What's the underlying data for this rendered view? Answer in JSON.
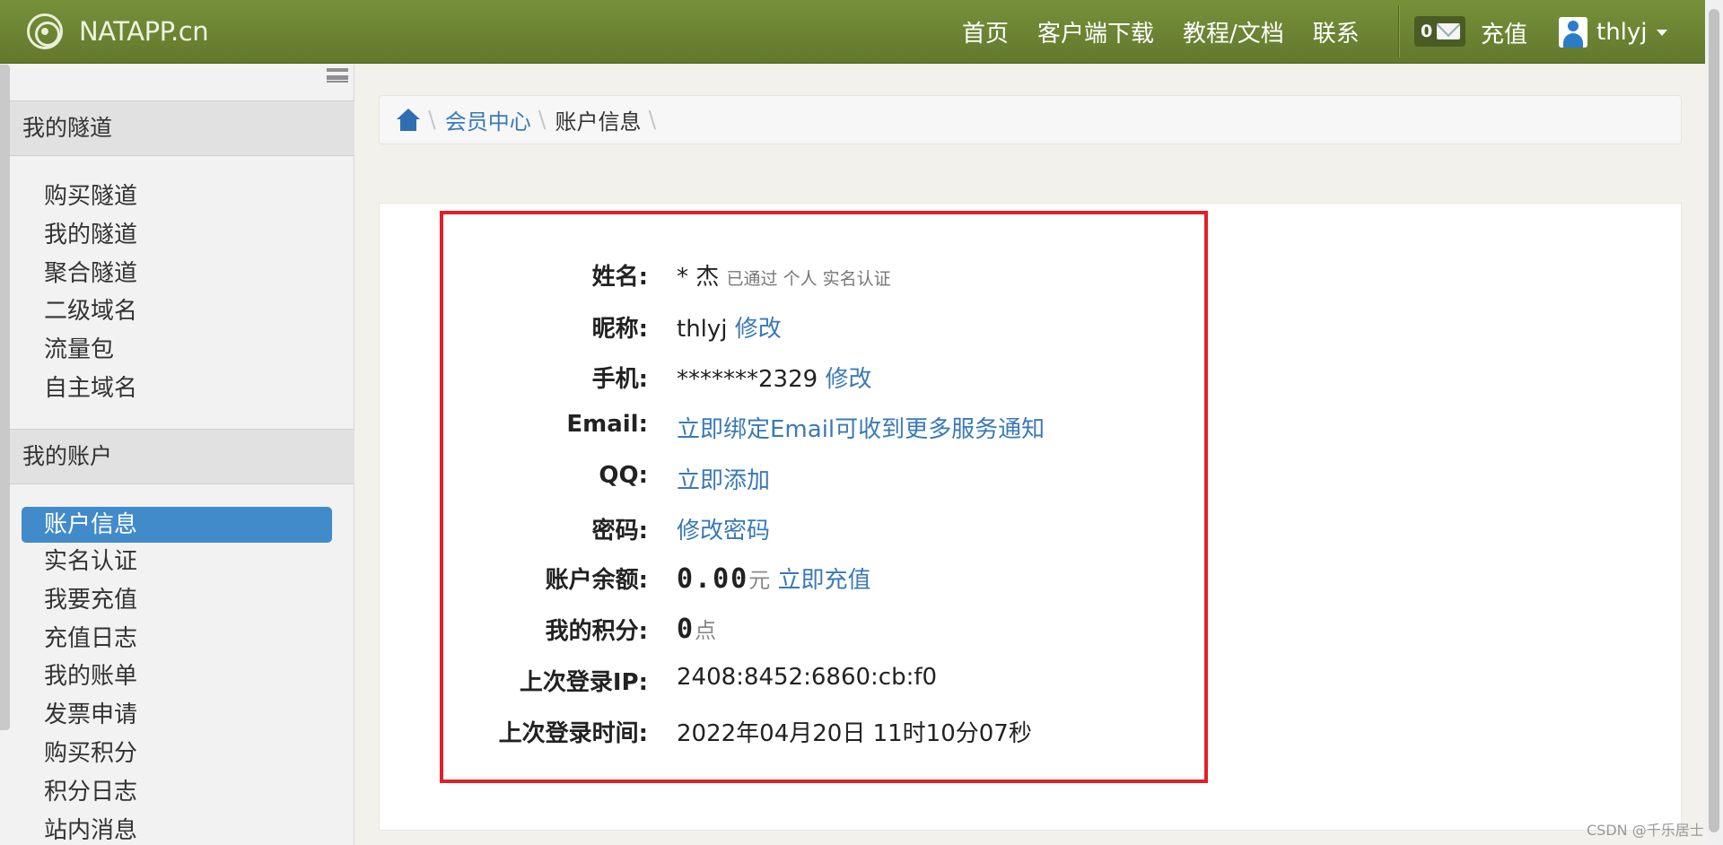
{
  "navbar": {
    "brand": "NATAPP.cn",
    "links": [
      "首页",
      "客户端下载",
      "教程/文档",
      "联系"
    ],
    "message_count": "0",
    "recharge": "充值",
    "username": "thlyj"
  },
  "sidebar": {
    "section1": {
      "title": "我的隧道",
      "items": [
        "购买隧道",
        "我的隧道",
        "聚合隧道",
        "二级域名",
        "流量包",
        "自主域名"
      ]
    },
    "section2": {
      "title": "我的账户",
      "items": [
        "账户信息",
        "实名认证",
        "我要充值",
        "充值日志",
        "我的账单",
        "发票申请",
        "购买积分",
        "积分日志",
        "站内消息"
      ],
      "active_index": 0
    }
  },
  "breadcrumb": {
    "parent": "会员中心",
    "current": "账户信息"
  },
  "account": {
    "name_label": "姓名:",
    "name_value": "* 杰",
    "name_note": "已通过 个人 实名认证",
    "nickname_label": "昵称:",
    "nickname_value": "thlyj",
    "nickname_edit": "修改",
    "phone_label": "手机:",
    "phone_value": "*******2329",
    "phone_edit": "修改",
    "email_label": "Email:",
    "email_link": "立即绑定Email可收到更多服务通知",
    "qq_label": "QQ:",
    "qq_link": "立即添加",
    "password_label": "密码:",
    "password_link": "修改密码",
    "balance_label": "账户余额:",
    "balance_value": "0.00",
    "balance_unit": "元",
    "balance_link": "立即充值",
    "points_label": "我的积分:",
    "points_value": "0",
    "points_unit": "点",
    "last_ip_label": "上次登录IP:",
    "last_ip_value": "2408:8452:6860:cb:f0",
    "last_time_label": "上次登录时间:",
    "last_time_value": "2022年04月20日 11时10分07秒"
  },
  "watermark": "CSDN @千乐居士",
  "colors": {
    "navbar": "#6a8233",
    "accent_link": "#3a79b7",
    "active_item": "#428bca",
    "highlight_border": "#e21f26"
  }
}
